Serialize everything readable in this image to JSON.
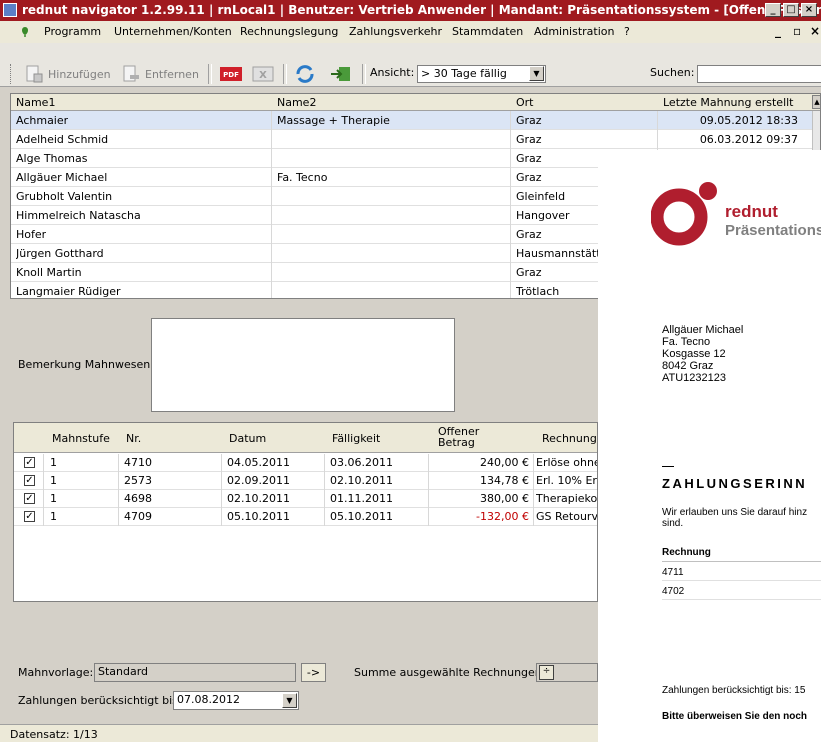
{
  "window": {
    "title": "rednut navigator 1.2.99.11  | rnLocal1 | Benutzer: Vertrieb Anwender | Mandant: Präsentationssystem - [Offene Posten / Ma..."
  },
  "menu": {
    "items": [
      "Programm",
      "Unternehmen/Konten",
      "Rechnungslegung",
      "Zahlungsverkehr",
      "Stammdaten",
      "Administration",
      "?"
    ]
  },
  "toolbar": {
    "add_label": "Hinzufügen",
    "remove_label": "Entfernen",
    "view_label": "Ansicht:",
    "view_value": "> 30 Tage fällig",
    "search_label": "Suchen:"
  },
  "customers": {
    "headers": [
      "Name1",
      "Name2",
      "Ort",
      "Letzte Mahnung erstellt"
    ],
    "rows": [
      [
        "Achmaier",
        "Massage + Therapie",
        "Graz",
        "09.05.2012 18:33"
      ],
      [
        "Adelheid Schmid",
        "",
        "Graz",
        "06.03.2012 09:37"
      ],
      [
        "Alge Thomas",
        "",
        "Graz",
        ""
      ],
      [
        "Allgäuer Michael",
        "Fa. Tecno",
        "Graz",
        ""
      ],
      [
        "Grubholt Valentin",
        "",
        "Gleinfeld",
        ""
      ],
      [
        "Himmelreich Natascha",
        "",
        "Hangover",
        ""
      ],
      [
        "Hofer",
        "",
        "Graz",
        ""
      ],
      [
        "Jürgen Gotthard",
        "",
        "Hausmannstätter",
        ""
      ],
      [
        "Knoll Martin",
        "",
        "Graz",
        ""
      ],
      [
        "Langmaier Rüdiger",
        "",
        "Trötlach",
        ""
      ]
    ]
  },
  "remark": {
    "label": "Bemerkung Mahnwesen:"
  },
  "invoices": {
    "headers": [
      "Mahnstufe",
      "Nr.",
      "Datum",
      "Fälligkeit",
      "Offener Betrag",
      "Rechnung"
    ],
    "rows": [
      [
        "1",
        "4710",
        "04.05.2011",
        "03.06.2011",
        "240,00 €",
        "Erlöse ohne"
      ],
      [
        "1",
        "2573",
        "02.09.2011",
        "02.10.2011",
        "134,78 €",
        "Erl. 10% Er"
      ],
      [
        "1",
        "4698",
        "02.10.2011",
        "01.11.2011",
        "380,00 €",
        "Therapieko"
      ],
      [
        "1",
        "4709",
        "05.10.2011",
        "05.10.2011",
        "-132,00 €",
        "GS Retourv"
      ]
    ],
    "negative_color": "#c00000"
  },
  "bottom": {
    "template_label": "Mahnvorlage:",
    "template_value": "Standard",
    "arrow_label": "->",
    "sum_label": "Summe ausgewählte Rechnungen:",
    "payments_label": "Zahlungen berücksichtigt bis:",
    "payments_value": "07.08.2012"
  },
  "status": {
    "text": "Datensatz: 1/13"
  },
  "preview": {
    "brand": "rednut",
    "brand_sub": "Präsentationss",
    "address": [
      "Allgäuer Michael",
      "Fa. Tecno",
      "Kosgasse 12",
      "8042 Graz",
      "ATU1232123"
    ],
    "heading": "ZAHLUNGSERINN",
    "intro": [
      "Wir erlauben uns Sie darauf hinz",
      "sind."
    ],
    "table_header": "Rechnung",
    "table_rows": [
      "4711",
      "4702"
    ],
    "payments_line": "Zahlungen berücksichtigt bis: 15",
    "transfer_line": "Bitte überweisen Sie den noch",
    "brand_color": "#b01e2e"
  }
}
